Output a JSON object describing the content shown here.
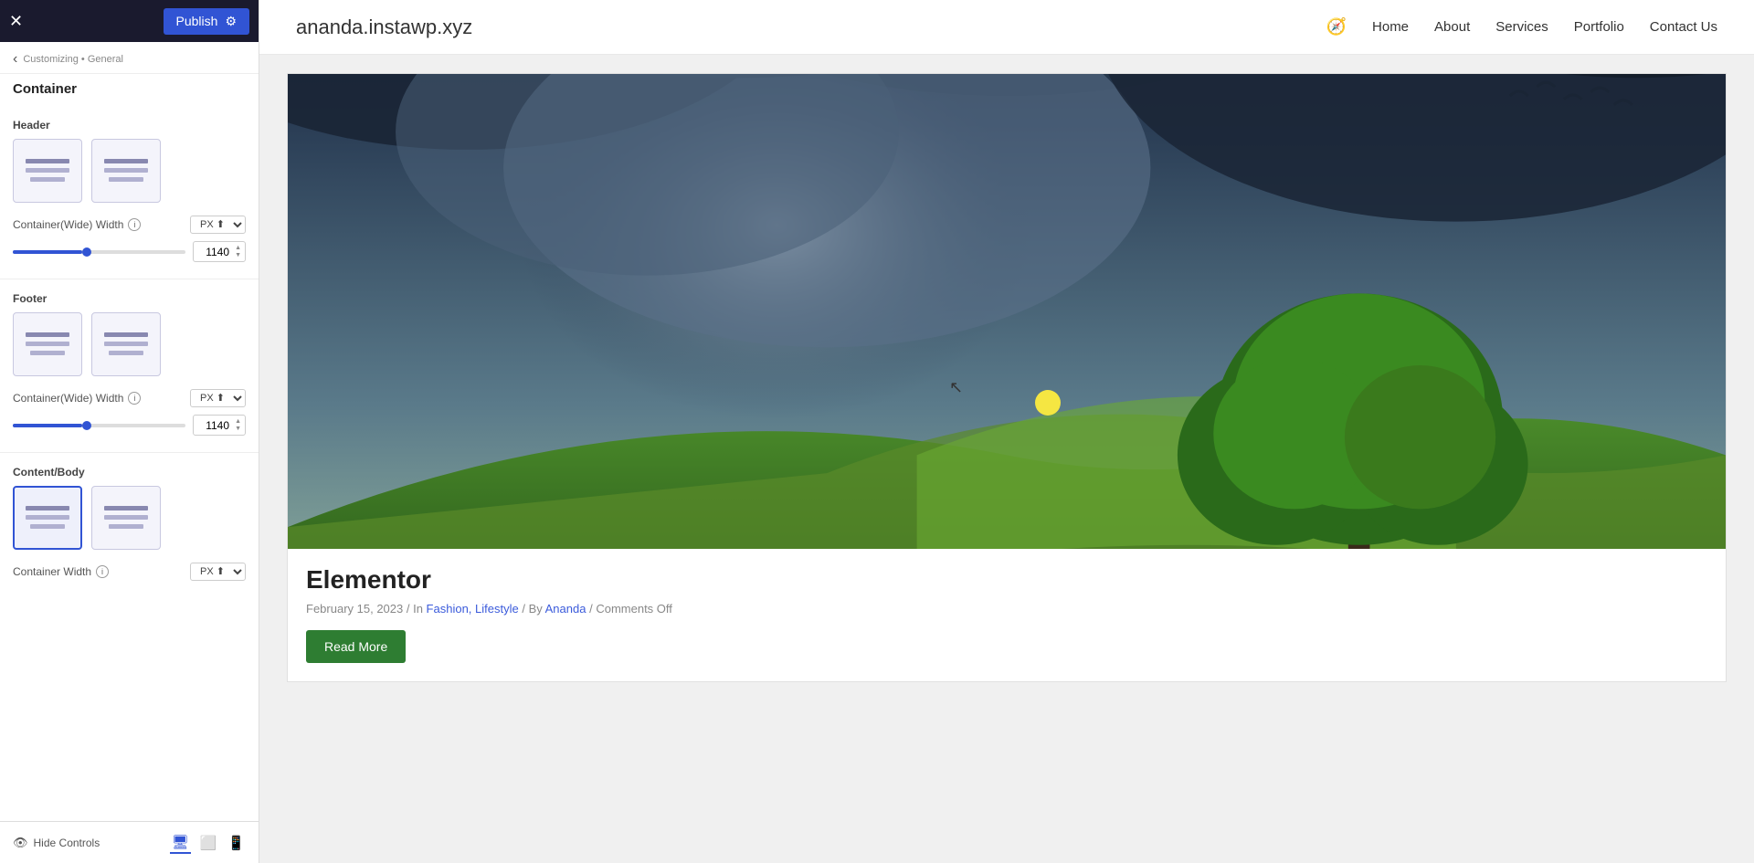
{
  "topbar": {
    "close_icon": "✕",
    "publish_label": "Publish",
    "gear_icon": "⚙"
  },
  "breadcrumb": {
    "back_icon": "‹",
    "path": "Customizing • General"
  },
  "panel": {
    "title": "Container",
    "sections": {
      "header": {
        "label": "Header",
        "container_wide_width_label": "Container(Wide) Width",
        "width_value": "1140",
        "unit": "PX",
        "slider_fill_pct": "40"
      },
      "footer": {
        "label": "Footer",
        "container_wide_width_label": "Container(Wide) Width",
        "width_value": "1140",
        "unit": "PX",
        "slider_fill_pct": "40"
      },
      "content_body": {
        "label": "Content/Body",
        "container_width_label": "Container Width",
        "unit": "PX"
      }
    }
  },
  "hide_controls": {
    "label": "Hide Controls",
    "eye_icon": "👁"
  },
  "device_icons": {
    "desktop": "🖥",
    "tablet": "📱",
    "mobile": "📲"
  },
  "nav": {
    "logo": "ananda.instawp.xyz",
    "compass_icon": "🧭",
    "links": [
      {
        "label": "Home"
      },
      {
        "label": "About"
      },
      {
        "label": "Services"
      },
      {
        "label": "Portfolio"
      },
      {
        "label": "Contact Us"
      }
    ]
  },
  "post": {
    "title": "Elementor",
    "date": "February 15, 2023",
    "categories": "Fashion, Lifestyle",
    "author": "Ananda",
    "comments": "Comments Off",
    "read_more": "Read More"
  }
}
